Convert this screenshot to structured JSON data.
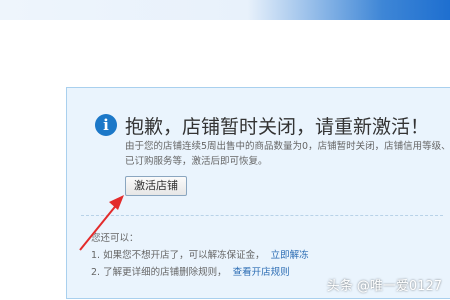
{
  "notice": {
    "title": "抱歉，店铺暂时关闭，请重新激活！",
    "description": "由于您的店铺连续5周出售中的商品数量为0，店铺暂时关闭，店铺信用等级、已订购服务等，激活后即可恢复。",
    "activate_button": "激活店铺",
    "options_heading": "您还可以：",
    "options": [
      {
        "text": "1. 如果您不想开店了，可以解冻保证金，",
        "link": "立即解冻"
      },
      {
        "text": "2. 了解更详细的店铺删除规则，",
        "link": "查看开店规则"
      }
    ]
  },
  "watermark": "头条 @唯一爱0127",
  "colors": {
    "accent": "#1c78c8",
    "panel_bg": "#eaf4fd",
    "link": "#2c6db4",
    "arrow": "#e32b2b"
  }
}
